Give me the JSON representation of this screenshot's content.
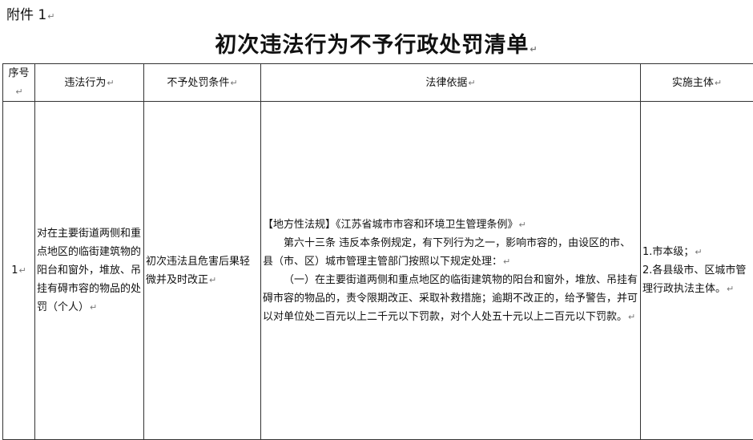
{
  "header": {
    "attachment_label": "附件 1",
    "title": "初次违法行为不予行政处罚清单"
  },
  "table": {
    "columns": [
      "序号",
      "违法行为",
      "不予处罚条件",
      "法律依据",
      "实施主体"
    ],
    "rows": [
      {
        "index": "1",
        "violation": "对在主要街道两侧和重点地区的临街建筑物的阳台和窗外，堆放、吊挂有碍市容的物品的处罚（个人）",
        "condition": "初次违法且危害后果轻微并及时改正",
        "basis": {
          "source": "【地方性法规】《江苏省城市市容和环境卫生管理条例》",
          "article": "第六十三条 违反本条例规定，有下列行为之一，影响市容的，由设区的市、县（市、区）城市管理主管部门按照以下规定处理：",
          "clause": "（一）在主要街道两侧和重点地区的临街建筑物的阳台和窗外，堆放、吊挂有碍市容的物品的，责令限期改正、采取补救措施；逾期不改正的，给予警告，并可以对单位处二百元以上二千元以下罚款，对个人处五十元以上二百元以下罚款。"
        },
        "enforcer": [
          "1.市本级；",
          "2.各县级市、区城市管理行政执法主体。"
        ]
      }
    ]
  }
}
